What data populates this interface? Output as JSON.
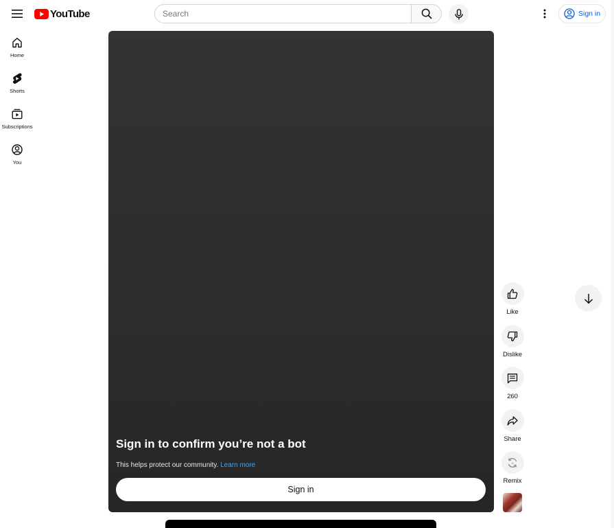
{
  "header": {
    "logo_text": "YouTube",
    "search_placeholder": "Search",
    "sign_in_label": "Sign in",
    "icons": [
      "menu-icon",
      "search-icon",
      "microphone-icon",
      "more-vertical-icon",
      "account-circle-icon"
    ]
  },
  "sidebar": {
    "items": [
      {
        "label": "Home",
        "icon": "home-icon"
      },
      {
        "label": "Shorts",
        "icon": "shorts-icon"
      },
      {
        "label": "Subscriptions",
        "icon": "subscriptions-icon"
      },
      {
        "label": "You",
        "icon": "you-icon"
      }
    ]
  },
  "player": {
    "title": "Sign in to confirm you’re not a bot",
    "description": "This helps protect our community.",
    "learn_more": "Learn more",
    "sign_in_label": "Sign in"
  },
  "actions": {
    "like": "Like",
    "dislike": "Dislike",
    "comments": "260",
    "share": "Share",
    "remix": "Remix"
  },
  "colors": {
    "brand_red": "#ff0000",
    "link_blue": "#065fd4",
    "player_link": "#3ea6ff",
    "chip_bg": "#f2f2f2"
  }
}
